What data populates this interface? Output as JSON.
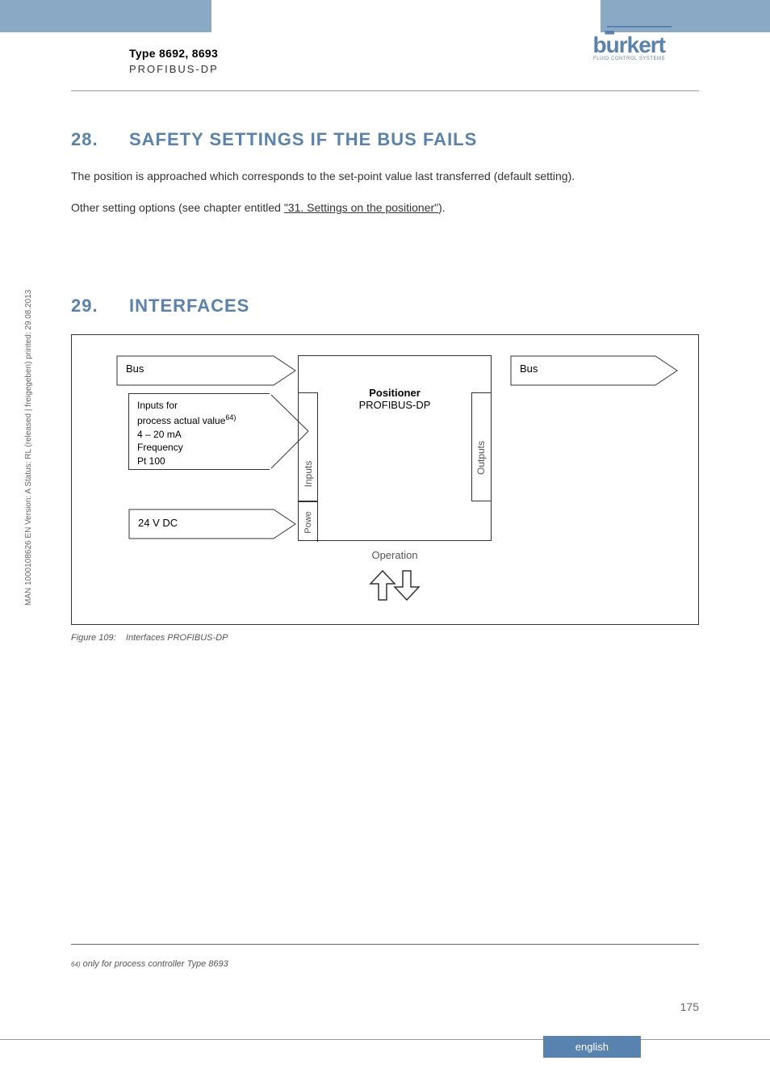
{
  "header": {
    "type_text": "Type 8692, 8693",
    "subtitle": "PROFIBUS-DP",
    "logo_text": "burkert",
    "logo_subtitle": "FLUID CONTROL SYSTEMS"
  },
  "section28": {
    "number": "28.",
    "title": "SAFETY SETTINGS IF THE BUS FAILS",
    "para1": "The position is approached which corresponds to the set-point value last transferred (default setting).",
    "para2_pre": "Other setting options (see chapter entitled ",
    "para2_link": "\"31. Settings on the positioner\"",
    "para2_post": ")."
  },
  "section29": {
    "number": "29.",
    "title": "INTERFACES"
  },
  "diagram": {
    "bus": "Bus",
    "inputs_lines": {
      "l1": "Inputs for",
      "l2_pre": "process actual value",
      "l2_sup": "64)",
      "l3": "4 – 20 mA",
      "l4": "Frequency",
      "l5": "Pt 100"
    },
    "dc_input": "24 V DC",
    "center_title": "Positioner",
    "center_sub": "PROFIBUS-DP",
    "inputs_label": "Inputs",
    "power_label": "Powe",
    "outputs_label": "Outputs",
    "operation": "Operation"
  },
  "figure_caption": {
    "num": "Figure 109:",
    "text": "Interfaces PROFIBUS-DP"
  },
  "footnote": {
    "num": "64)",
    "text": " only for process controller Type 8693"
  },
  "page_number": "175",
  "english_tab": "english",
  "side_text": "MAN 1000108626 EN Version: A Status: RL (released | freigegeben) printed: 29.08.2013",
  "chart_data": {
    "type": "diagram",
    "description": "Block diagram showing PROFIBUS-DP positioner interfaces",
    "inputs": [
      {
        "name": "Bus",
        "type": "bus"
      },
      {
        "name": "Inputs for process actual value (4-20 mA, Frequency, Pt 100)",
        "type": "signal",
        "note": "only for process controller Type 8693"
      },
      {
        "name": "24 V DC",
        "type": "power"
      }
    ],
    "center_block": {
      "title": "Positioner",
      "subtitle": "PROFIBUS-DP",
      "left_ports": [
        "Inputs",
        "Power"
      ],
      "right_ports": [
        "Outputs"
      ]
    },
    "outputs": [
      {
        "name": "Bus",
        "type": "bus"
      }
    ],
    "bottom_label": "Operation",
    "bottom_arrows": "bidirectional"
  }
}
